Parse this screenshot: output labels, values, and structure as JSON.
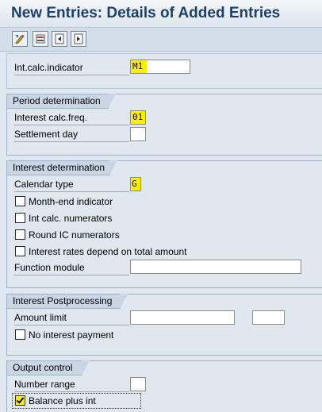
{
  "window": {
    "title": "New Entries: Details of Added Entries"
  },
  "toolbar": {
    "buttons": [
      {
        "icon": "change-display-icon"
      },
      {
        "icon": "delete-icon"
      },
      {
        "icon": "previous-entry-icon"
      },
      {
        "icon": "next-entry-icon"
      }
    ]
  },
  "header": {
    "int_calc_indicator_label": "Int.calc.indicator",
    "int_calc_indicator_value": "M1"
  },
  "period_determination": {
    "title": "Period determination",
    "interest_calc_freq_label": "Interest calc.freq.",
    "interest_calc_freq_value": "01",
    "settlement_day_label": "Settlement day",
    "settlement_day_value": ""
  },
  "interest_determination": {
    "title": "Interest determination",
    "calendar_type_label": "Calendar type",
    "calendar_type_value": "G",
    "month_end_label": "Month-end indicator",
    "int_calc_numerators_label": "Int calc. numerators",
    "round_ic_numerators_label": "Round IC numerators",
    "rates_total_amount_label": "Interest rates depend on total amount",
    "function_module_label": "Function module",
    "function_module_value": ""
  },
  "interest_postprocessing": {
    "title": "Interest Postprocessing",
    "amount_limit_label": "Amount limit",
    "amount_limit_value": "",
    "amount_limit_currency": "",
    "no_interest_payment_label": "No interest payment"
  },
  "output_control": {
    "title": "Output control",
    "number_range_label": "Number range",
    "number_range_value": "",
    "balance_plus_int_label": "Balance plus int",
    "balance_plus_int_checked": true
  },
  "colors": {
    "background": "#dfe7ef",
    "title_text": "#1d3f6e",
    "highlight": "#fff000"
  }
}
